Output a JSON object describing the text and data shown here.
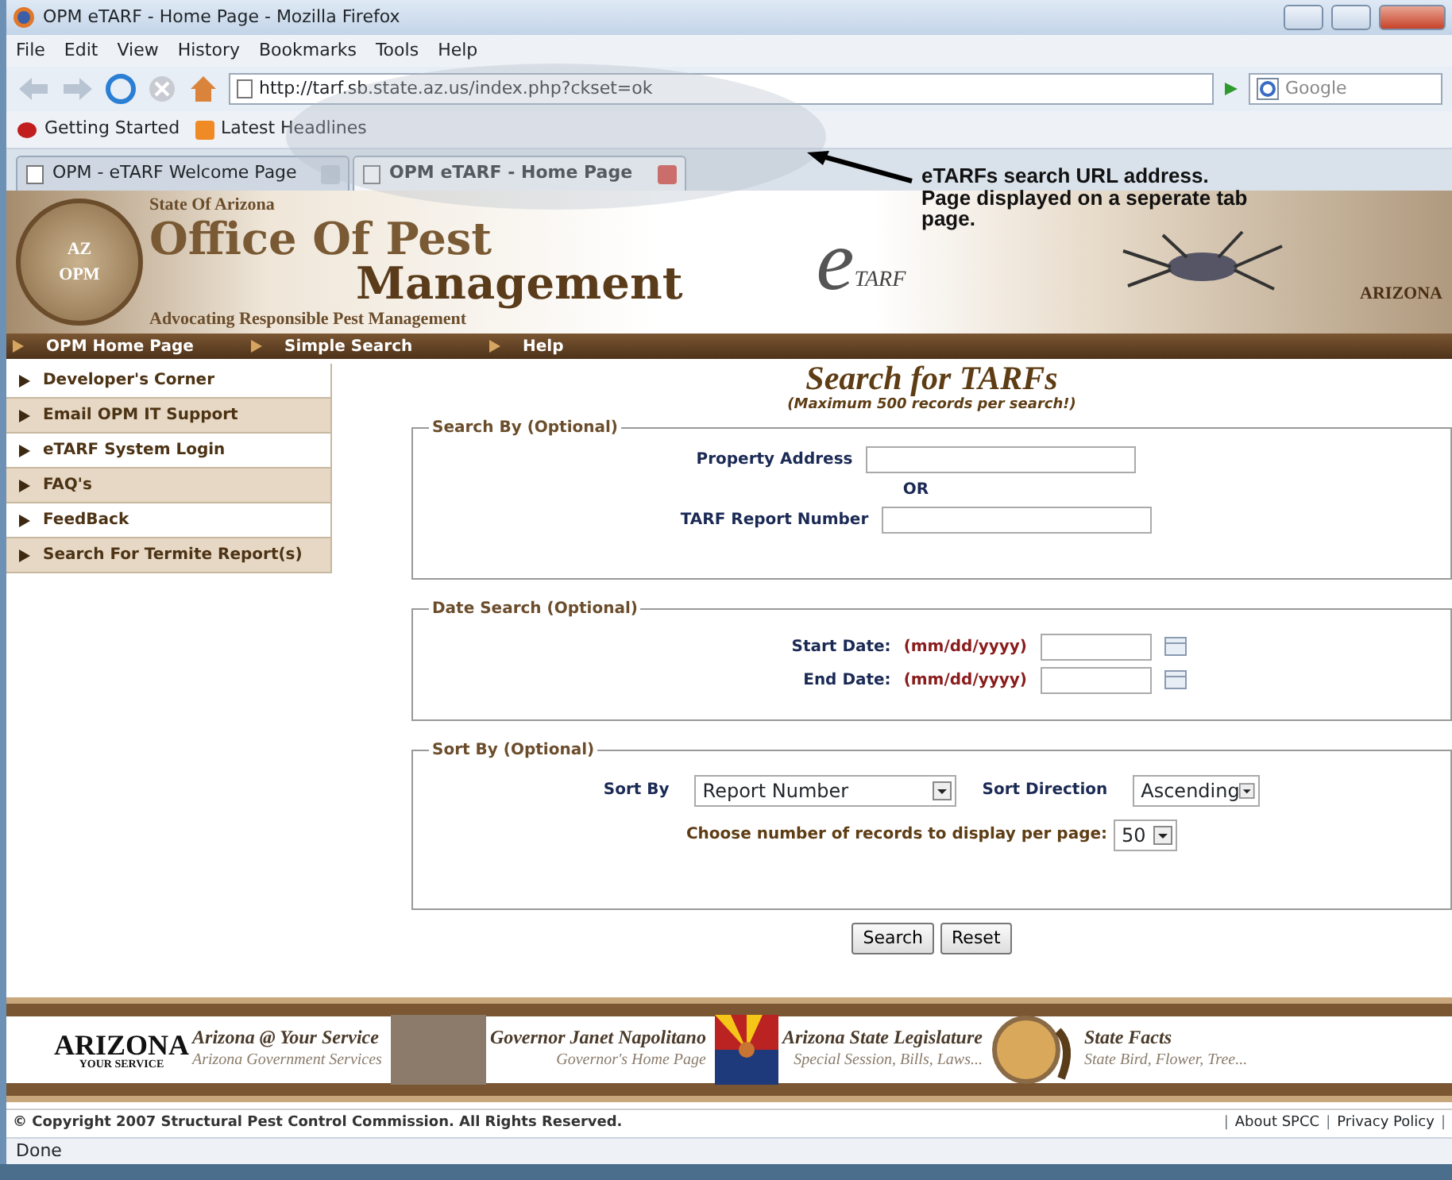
{
  "window": {
    "title": "OPM eTARF - Home Page - Mozilla Firefox"
  },
  "menu": [
    "File",
    "Edit",
    "View",
    "History",
    "Bookmarks",
    "Tools",
    "Help"
  ],
  "toolbar": {
    "url": "http://tarf.sb.state.az.us/index.php?ckset=ok",
    "search_placeholder": "Google"
  },
  "bookmarks": [
    "Getting Started",
    "Latest Headlines"
  ],
  "tabs": [
    {
      "label": "OPM - eTARF Welcome Page",
      "selected": false
    },
    {
      "label": "OPM eTARF - Home Page",
      "selected": true
    }
  ],
  "annotation": {
    "text": "eTARFs search URL address. Page displayed on a seperate tab page."
  },
  "banner": {
    "state": "State Of Arizona",
    "line1": "Office Of Pest",
    "line2": "Management",
    "motto": "Advocating Responsible Pest Management",
    "seal_az": "AZ",
    "seal_opm": "OPM",
    "logo_e": "e",
    "logo_tarf": "TARF",
    "arizona": "ARIZONA"
  },
  "nav": [
    "OPM Home Page",
    "Simple Search",
    "Help"
  ],
  "sidebar": [
    {
      "label": "Developer's Corner"
    },
    {
      "label": "Email OPM IT Support"
    },
    {
      "label": "eTARF System Login"
    },
    {
      "label": "FAQ's"
    },
    {
      "label": "FeedBack"
    },
    {
      "label": "Search For Termite Report(s)"
    }
  ],
  "main": {
    "title": "Search for TARFs",
    "subtitle": "(Maximum 500 records per search!)",
    "search_by": {
      "legend": "Search By (Optional)",
      "address_label": "Property Address",
      "or": "OR",
      "number_label": "TARF Report Number"
    },
    "date_search": {
      "legend": "Date Search (Optional)",
      "start_label": "Start Date:",
      "start_format": "(mm/dd/yyyy)",
      "end_label": "End Date:",
      "end_format": "(mm/dd/yyyy)"
    },
    "sort": {
      "legend": "Sort By (Optional)",
      "sort_by_label": "Sort By",
      "sort_by": "Report Number",
      "direction_label": "Sort Direction",
      "direction": "Ascending",
      "per_page_label": "Choose number of records to display per page:",
      "per_page": "50"
    },
    "buttons": [
      "Search",
      "Reset"
    ]
  },
  "footer_links": [
    {
      "title": "Arizona @ Your Service",
      "subtitle": "Arizona Government Services",
      "kind": "logo"
    },
    {
      "title": "Governor Janet Napolitano",
      "subtitle": "Governor's Home Page",
      "kind": "photo"
    },
    {
      "title": "Arizona State Legislature",
      "subtitle": "Special Session, Bills, Laws...",
      "kind": "flag"
    },
    {
      "title": "State Facts",
      "subtitle": "State Bird, Flower, Tree...",
      "kind": "seal"
    }
  ],
  "footer_logo": {
    "name": "ARIZONA",
    "tagline": "YOUR SERVICE"
  },
  "copyright": "© Copyright 2007 Structural Pest Control Commission. All Rights Reserved.",
  "bottom_links": [
    {
      "kind": "separator",
      "text": "|"
    },
    {
      "kind": "link",
      "text": "About SPCC"
    },
    {
      "kind": "separator",
      "text": "|"
    },
    {
      "kind": "link",
      "text": "Privacy Policy"
    },
    {
      "kind": "separator",
      "text": "|"
    }
  ],
  "status_bar": "Done"
}
